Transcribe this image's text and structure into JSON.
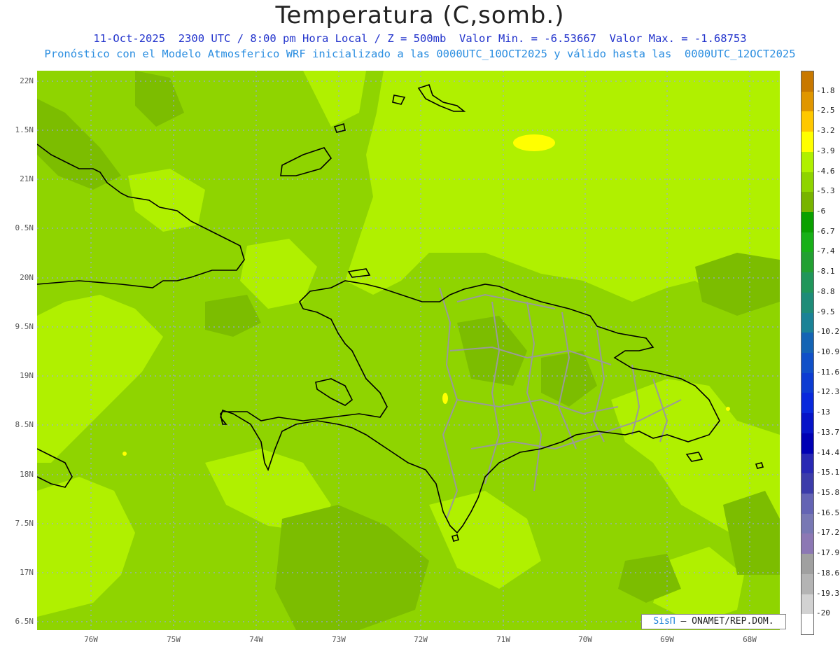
{
  "header": {
    "title": "Temperatura (C,somb.)",
    "subtitle_1": "11-Oct-2025  2300 UTC / 8:00 pm Hora Local / Z = 500mb  Valor Min. = -6.53667  Valor Max. = -1.68753",
    "subtitle_2": "Pronóstico con el Modelo Atmosferico WRF inicializado a las 0000UTC_10OCT2025 y válido hasta las  0000UTC_12OCT2025"
  },
  "map": {
    "lat_labels": [
      "22N",
      "1.5N",
      "21N",
      "0.5N",
      "20N",
      "9.5N",
      "19N",
      "8.5N",
      "18N",
      "7.5N",
      "17N",
      "6.5N"
    ],
    "lon_labels": [
      "76W",
      "75W",
      "74W",
      "73W",
      "72W",
      "71W",
      "70W",
      "69W",
      "68W"
    ],
    "colors": {
      "base": "#8fd400",
      "light": "#b0f000",
      "darker": "#7cbd00",
      "warm": "#ffff00",
      "coast": "#000000",
      "province": "#9a9a9a",
      "grid": "#9aa0ff"
    }
  },
  "credit": {
    "brand": "SisΠ",
    "text": "– ONAMET/REP.DOM."
  },
  "colorbar": {
    "labels": [
      "-1.8",
      "-2.5",
      "-3.2",
      "-3.9",
      "-4.6",
      "-5.3",
      "-6",
      "-6.7",
      "-7.4",
      "-8.1",
      "-8.8",
      "-9.5",
      "-10.2",
      "-10.9",
      "-11.6",
      "-12.3",
      "-13",
      "-13.7",
      "-14.4",
      "-15.1",
      "-15.8",
      "-16.5",
      "-17.2",
      "-17.9",
      "-18.6",
      "-19.3",
      "-20"
    ],
    "colors": [
      "#c87800",
      "#e09600",
      "#ffc800",
      "#ffff00",
      "#b0f000",
      "#8fd400",
      "#78b400",
      "#0aa000",
      "#18b018",
      "#22a032",
      "#20965a",
      "#1e8c78",
      "#1a8296",
      "#1464b4",
      "#1050c8",
      "#0c3cd2",
      "#0828dc",
      "#0614c8",
      "#0000b4",
      "#2828b4",
      "#3c3caa",
      "#6464b4",
      "#7878b4",
      "#8c78b4",
      "#a0a0a0",
      "#b4b4b4",
      "#d2d2d2",
      "#ffffff"
    ]
  }
}
